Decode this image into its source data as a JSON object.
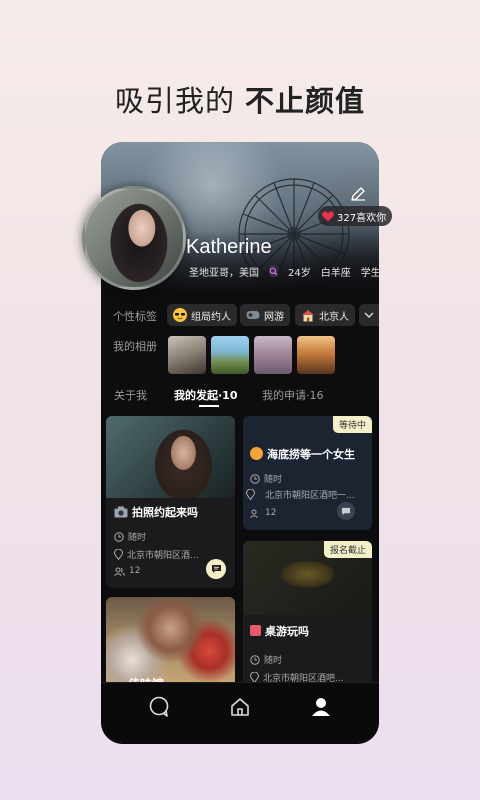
{
  "headline": {
    "part1": "吸引我的",
    "part2": "不止颜值"
  },
  "profile": {
    "name": "Katherine",
    "likes": "327喜欢你",
    "location": "圣地亚哥，美国",
    "age": "24岁",
    "zodiac": "白羊座",
    "occupation": "学生"
  },
  "tags": {
    "label": "个性标签",
    "items": [
      "组局约人",
      "网游",
      "北京人"
    ]
  },
  "album": {
    "label": "我的相册"
  },
  "tabs": [
    {
      "label": "关于我"
    },
    {
      "label": "我的发起·10"
    },
    {
      "label": "我的申请·16"
    }
  ],
  "cards": [
    {
      "title": "拍照约起来吗",
      "time": "随时",
      "place": "北京市朝阳区酒...",
      "count": "12"
    },
    {
      "badge": "等待中",
      "title": "海底捞等一个女生",
      "time": "随时",
      "place": "北京市朝阳区酒吧一...",
      "count": "12"
    },
    {
      "title": "佳味馆",
      "time": "",
      "place": "",
      "count": ""
    },
    {
      "badge": "报名截止",
      "title": "桌游玩吗",
      "time": "随时",
      "place": "北京市朝阳区酒吧..."
    }
  ],
  "colors": {
    "accent": "#e8334a",
    "badge_bg": "#f3efc9"
  }
}
